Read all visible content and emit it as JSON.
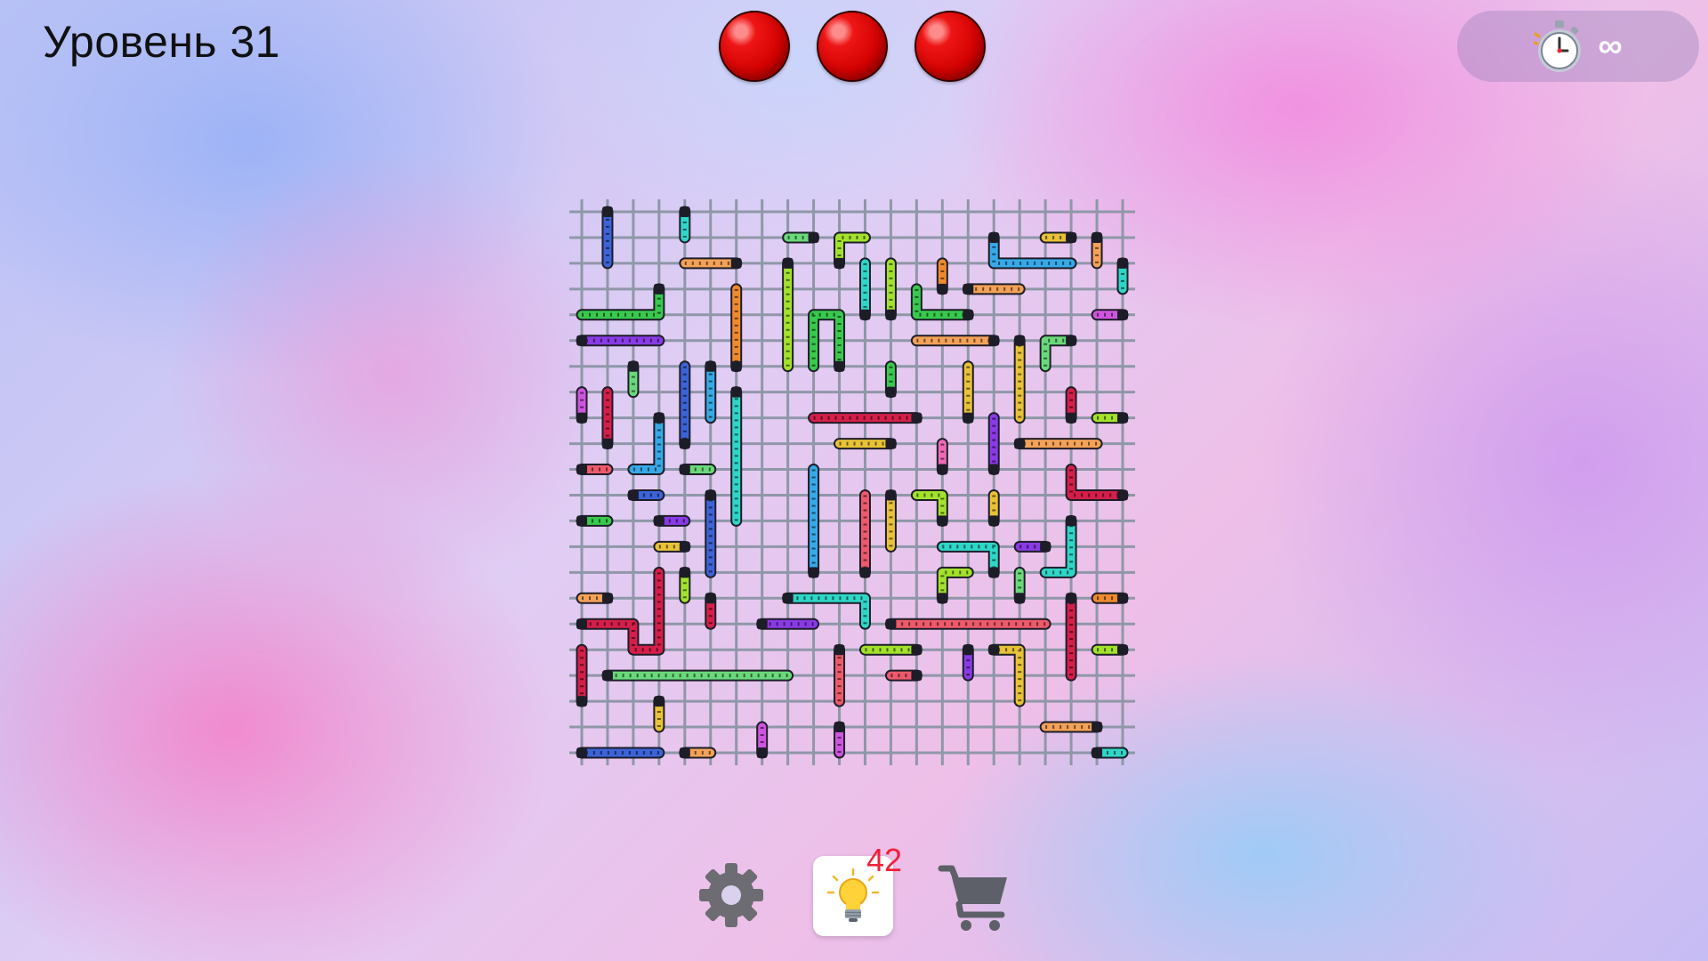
{
  "header": {
    "level_title": "Уровень 31",
    "lives_count": 3,
    "timer_value": "∞"
  },
  "colors": {
    "life": "#e00000",
    "grid_line": "#8f97a8",
    "hint_count": "#f0203a",
    "pieces": [
      "#d61e4a",
      "#f08a2e",
      "#e8c237",
      "#a3e22c",
      "#38c94d",
      "#2ed6c8",
      "#37a9e8",
      "#3c63d8",
      "#8a3ae6",
      "#cf55e0",
      "#ef6ab6",
      "#ee5a6b",
      "#6ad97a",
      "#f4a258"
    ]
  },
  "board": {
    "rows": 22,
    "cols": 22
  },
  "bottom": {
    "settings_icon": "gear-icon",
    "hint_icon": "lightbulb-icon",
    "hint_count": "42",
    "shop_icon": "shopping-cart-icon"
  }
}
